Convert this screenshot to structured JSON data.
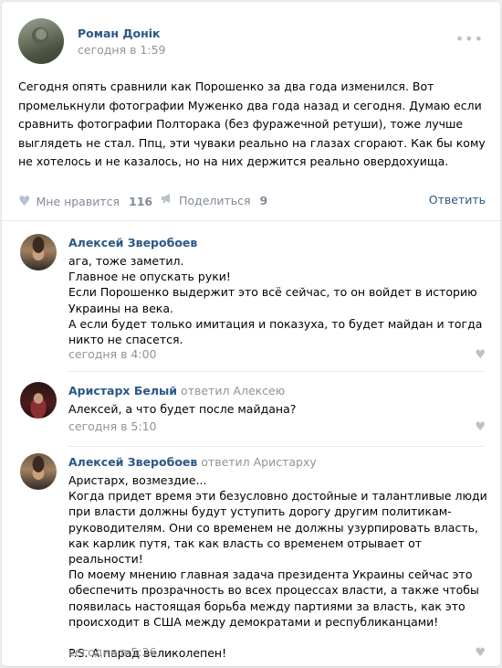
{
  "post": {
    "author": "Роман Донік",
    "date": "сегодня в 1:59",
    "more_icon": "more-dots-icon",
    "text": "Сегодня опять сравнили как Порошенко за два года изменился. Вот промелькнули фотографии Муженко два года назад и сегодня. Думаю если сравнить фотографии Полторака (без фуражечной ретуши), тоже лучше выглядеть не стал. Ппц, эти чуваки реально на глазах сгорают. Как бы кому не хотелось и не казалось, но на них держится реально овердохуища.",
    "like_label": "Мне нравится",
    "like_count": "116",
    "share_label": "Поделиться",
    "share_count": "9",
    "reply_label": "Ответить"
  },
  "comments": [
    {
      "author": "Алексей Зверобоев",
      "replied": "",
      "lines": [
        "ага, тоже заметил.",
        "Главное не опускать руки!",
        "Если Порошенко выдержит это всё сейчас, то он войдет в историю Украины на века.",
        "А если будет только имитация и показуха, то будет майдан и тогда никто не спасется."
      ],
      "date": "сегодня в 4:00"
    },
    {
      "author": "Аристарх Белый",
      "replied": "ответил Алексею",
      "lines": [
        "Алексей, а что будет после майдана?"
      ],
      "date": "сегодня в 5:10"
    },
    {
      "author": "Алексей Зверобоев",
      "replied": "ответил Аристарху",
      "lines": [
        "Аристарх, возмездие...",
        "Когда придет время эти безусловно достойные и талантливые люди при власти должны будут уступить дорогу другим политикам-руководителям. Они со временем не должны узурпировать власть, как карлик путя, так как власть со временем отрывает от реальности!",
        "По моему мнению главная задача президента Украины сейчас это обеспечить прозрачность во всех процессах власти, а также чтобы появилась настоящая борьба между партиями за власть, как это происходит в США между демократами и республиканцами!",
        "",
        "P.S. А парад великолепен!"
      ],
      "date": "сегодня в 5:26"
    }
  ],
  "colors": {
    "link": "#2a5885",
    "muted": "#939393",
    "icon": "#b8c2cc",
    "background": "#edeef0"
  }
}
